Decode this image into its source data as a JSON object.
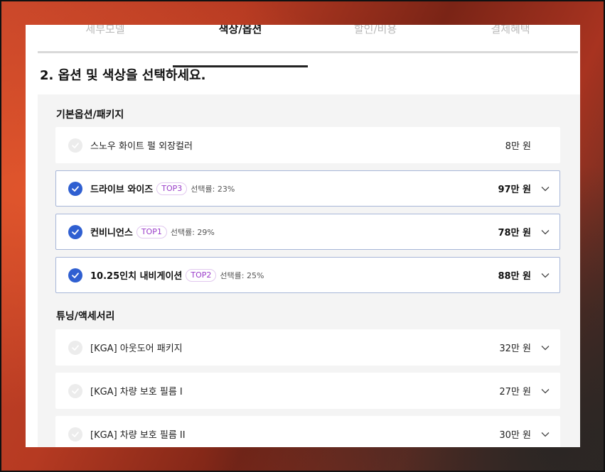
{
  "tabs": [
    {
      "label": "세부모델"
    },
    {
      "label": "색상/옵션"
    },
    {
      "label": "할인/비용"
    },
    {
      "label": "결제혜택"
    }
  ],
  "title": "2. 옵션 및 색상을 선택하세요.",
  "sections": [
    {
      "label": "기본옵션/패키지",
      "items": [
        {
          "name": "스노우 화이트 펄 외장컬러",
          "price": "8만 원"
        },
        {
          "name": "드라이브 와이즈",
          "badge": "TOP3",
          "rate": "선택률: 23%",
          "price": "97만 원"
        },
        {
          "name": "컨비니언스",
          "badge": "TOP1",
          "rate": "선택률: 29%",
          "price": "78만 원"
        },
        {
          "name": "10.25인치 내비게이션",
          "badge": "TOP2",
          "rate": "선택률: 25%",
          "price": "88만 원"
        }
      ]
    },
    {
      "label": "튜닝/액세서리",
      "items": [
        {
          "name": "[KGA] 아웃도어 패키지",
          "price": "32만 원"
        },
        {
          "name": "[KGA] 차량 보호 필름 I",
          "price": "27만 원"
        },
        {
          "name": "[KGA] 차량 보호 필름 II",
          "price": "30만 원"
        }
      ]
    }
  ],
  "colors": {
    "accent": "#2f5fd1",
    "badge_text": "#9a3cc9",
    "selected_border": "#a7b6d8"
  }
}
